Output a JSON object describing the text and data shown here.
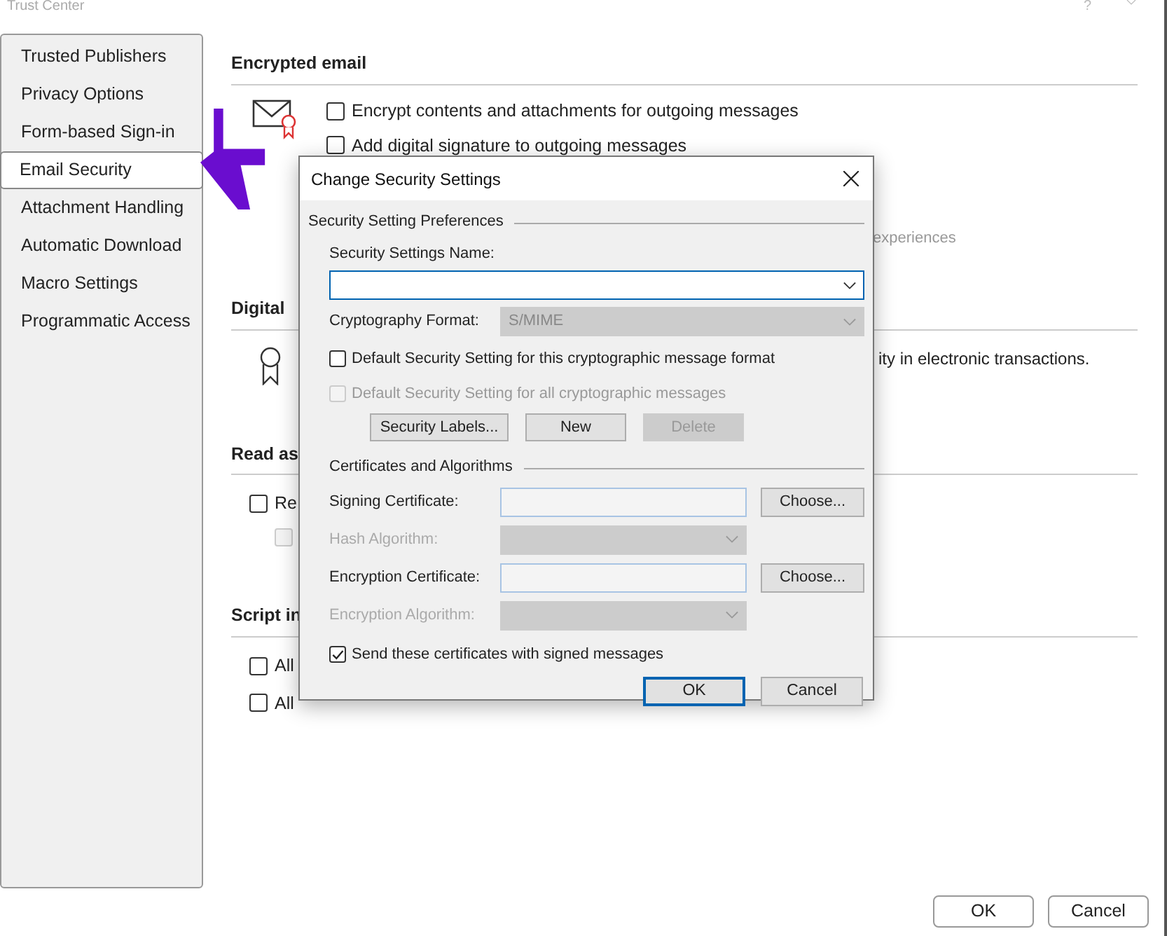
{
  "window": {
    "title": "Trust Center",
    "help": "?"
  },
  "sidebar": {
    "items": [
      {
        "label": "Trusted Publishers",
        "selected": false
      },
      {
        "label": "Privacy Options",
        "selected": false
      },
      {
        "label": "Form-based Sign-in",
        "selected": false
      },
      {
        "label": "Email Security",
        "selected": true
      },
      {
        "label": "Attachment Handling",
        "selected": false
      },
      {
        "label": "Automatic Download",
        "selected": false
      },
      {
        "label": "Macro Settings",
        "selected": false
      },
      {
        "label": "Programmatic Access",
        "selected": false
      }
    ]
  },
  "sections": [
    {
      "heading": "Encrypted email",
      "options": [
        {
          "label": "Encrypt contents and attachments for outgoing messages",
          "checked": false,
          "disabled": false
        },
        {
          "label": "Add digital signature to outgoing messages",
          "checked": false,
          "disabled": false
        }
      ],
      "partial_text": "experiences"
    },
    {
      "heading": "Digital",
      "partial_text": "ity in electronic transactions."
    },
    {
      "heading": "Read as",
      "options": [
        {
          "label": "Re",
          "checked": false,
          "disabled": false
        },
        {
          "checked": false,
          "disabled": true
        }
      ]
    },
    {
      "heading": "Script in",
      "options": [
        {
          "label": "All",
          "checked": false,
          "disabled": false
        },
        {
          "label": "All",
          "checked": false,
          "disabled": false
        }
      ]
    }
  ],
  "buttons": [
    {
      "label": "OK"
    },
    {
      "label": "Cancel"
    }
  ],
  "dialog": {
    "title": "Change Security Settings",
    "preferences": {
      "heading": "Security Setting Preferences",
      "name_label": "Security Settings Name:",
      "format_label": "Cryptography Format:",
      "format_value": "S/MIME",
      "defaults": [
        {
          "label": "Default Security Setting for this cryptographic message format",
          "checked": false,
          "disabled": false
        },
        {
          "label": "Default Security Setting for all cryptographic messages",
          "checked": false,
          "disabled": true
        }
      ],
      "buttons": [
        {
          "label": "Security Labels...",
          "disabled": false
        },
        {
          "label": "New",
          "disabled": false
        },
        {
          "label": "Delete",
          "disabled": true
        }
      ]
    },
    "certificates": {
      "heading": "Certificates and Algorithms",
      "rows": [
        {
          "kind": "field",
          "label": "Signing Certificate:",
          "disabled": false,
          "button": "Choose..."
        },
        {
          "kind": "select",
          "label": "Hash Algorithm:",
          "disabled": true
        },
        {
          "kind": "field",
          "label": "Encryption Certificate:",
          "disabled": false,
          "button": "Choose..."
        },
        {
          "kind": "select",
          "label": "Encryption Algorithm:",
          "disabled": true
        }
      ],
      "send": {
        "label": "Send these certificates with signed messages",
        "checked": true,
        "disabled": false
      }
    },
    "buttons": [
      {
        "label": "OK",
        "default": true
      },
      {
        "label": "Cancel",
        "default": false
      }
    ]
  }
}
